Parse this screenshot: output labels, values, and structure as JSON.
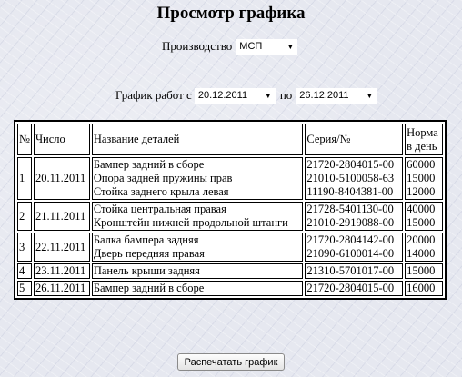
{
  "page": {
    "title": "Просмотр графика"
  },
  "production": {
    "label": "Производство",
    "value": "МСП"
  },
  "schedule": {
    "label": "График работ с",
    "from": "20.12.2011",
    "between": "по",
    "to": "26.12.2011"
  },
  "table": {
    "headers": {
      "num": "№",
      "date": "Число",
      "name": "Название деталей",
      "series": "Серия/№",
      "norm_line1": "Норма",
      "norm_line2": "в день"
    },
    "rows": [
      {
        "num": "1",
        "date": "20.11.2011",
        "items": [
          {
            "name": "Бампер задний в сборе",
            "series": "21720-2804015-00",
            "norm": "60000"
          },
          {
            "name": "Опора задней пружины прав",
            "series": "21010-5100058-63",
            "norm": "15000"
          },
          {
            "name": "Стойка заднего крыла левая",
            "series": "11190-8404381-00",
            "norm": "12000"
          }
        ]
      },
      {
        "num": "2",
        "date": "21.11.2011",
        "items": [
          {
            "name": "Стойка центральная правая",
            "series": "21728-5401130-00",
            "norm": "40000"
          },
          {
            "name": "Кронштейн нижней продольной штанги",
            "series": "21010-2919088-00",
            "norm": "15000"
          }
        ]
      },
      {
        "num": "3",
        "date": "22.11.2011",
        "items": [
          {
            "name": "Балка бампера задняя",
            "series": "21720-2804142-00",
            "norm": "20000"
          },
          {
            "name": "Дверь передняя правая",
            "series": "21090-6100014-00",
            "norm": "14000"
          }
        ]
      },
      {
        "num": "4",
        "date": "23.11.2011",
        "items": [
          {
            "name": "Панель крыши задняя",
            "series": "21310-5701017-00",
            "norm": "15000"
          }
        ]
      },
      {
        "num": "5",
        "date": "26.11.2011",
        "items": [
          {
            "name": "Бампер задний в сборе",
            "series": "21720-2804015-00",
            "norm": "16000"
          }
        ]
      }
    ]
  },
  "print_button": {
    "label": "Распечатать график"
  }
}
